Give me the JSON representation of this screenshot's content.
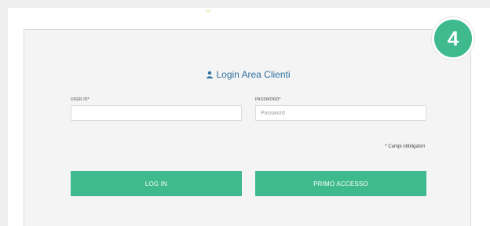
{
  "step_badge": {
    "number": "4",
    "color": "#3fba8f"
  },
  "login": {
    "title": "Login Area Clienti",
    "title_icon": "user-icon",
    "title_color": "#2f6f9f"
  },
  "fields": {
    "user_id_label": "USER ID*",
    "user_id_value": "",
    "user_id_placeholder": "",
    "password_label": "PASSWORD*",
    "password_value": "",
    "password_placeholder": "Password"
  },
  "required_note": "* Campi obbligatori",
  "buttons": {
    "login_label": "LOG IN",
    "first_access_label": "PRIMO ACCESSO",
    "color": "#3fba8f"
  }
}
